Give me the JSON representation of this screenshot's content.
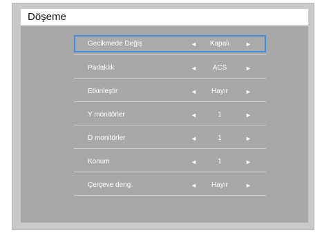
{
  "screen": {
    "title": "Döşeme"
  },
  "menu": {
    "items": [
      {
        "label": "Gecikmede Değiş",
        "value": "Kapalı",
        "selected": true
      },
      {
        "label": "Parlaklık",
        "value": "ACS"
      },
      {
        "label": "Etkinleştir",
        "value": "Hayır"
      },
      {
        "label": "Y monitörler",
        "value": "1"
      },
      {
        "label": "D monitörler",
        "value": "1"
      },
      {
        "label": "Konum",
        "value": "1"
      },
      {
        "label": "Çerçeve deng.",
        "value": "Hayır"
      }
    ],
    "arrow_left": "◄",
    "arrow_right": "►"
  },
  "colors": {
    "frame": "#c9c9c9",
    "panel": "#a8a8a8",
    "selection_border": "#3a8ee6",
    "text": "#ffffff"
  }
}
